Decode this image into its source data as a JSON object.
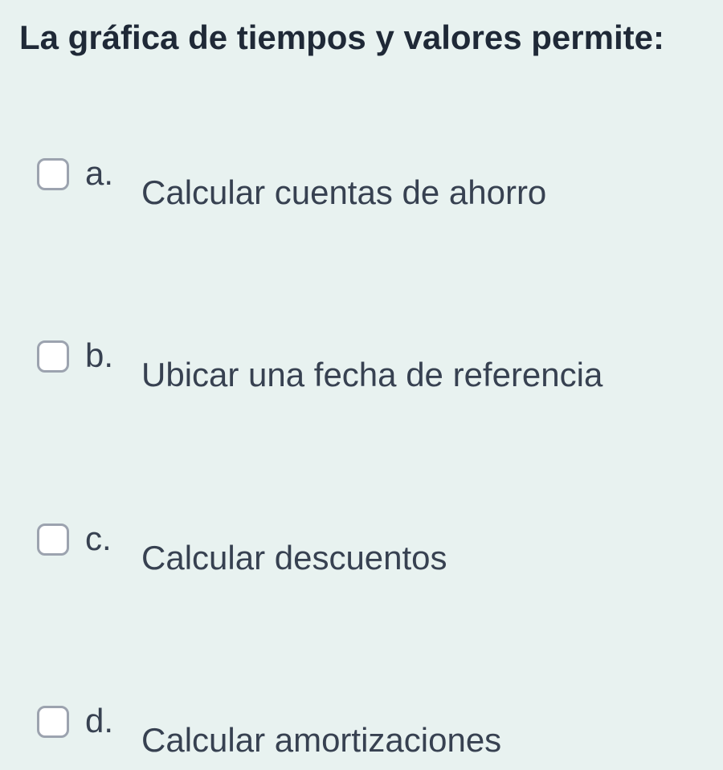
{
  "question": {
    "title": "La gráfica de tiempos y valores permite:"
  },
  "options": [
    {
      "letter": "a.",
      "text": "Calcular cuentas de ahorro"
    },
    {
      "letter": "b.",
      "text": "Ubicar una fecha de referencia"
    },
    {
      "letter": "c.",
      "text": "Calcular descuentos"
    },
    {
      "letter": "d.",
      "text": "Calcular amortizaciones"
    }
  ]
}
